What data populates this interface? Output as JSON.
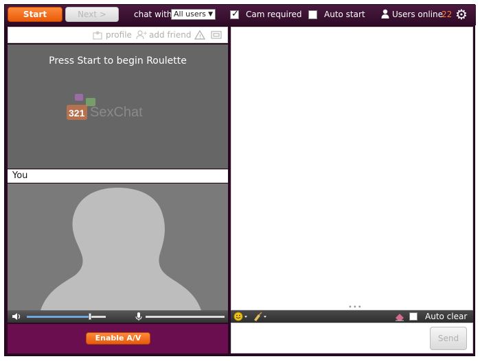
{
  "colors": {
    "frame": "#2a0a22",
    "accent_orange": "#e85a0a",
    "enable_panel": "#6a0e4f",
    "count_orange": "#ff7a2a"
  },
  "topbar": {
    "start_label": "Start",
    "next_label": "Next >",
    "chat_with_label": "chat with",
    "chat_with_selected": "All users",
    "cam_required_label": "Cam required",
    "cam_required_checked": true,
    "auto_start_label": "Auto start",
    "auto_start_checked": false,
    "users_online_label": "Users online",
    "users_online_count": "22"
  },
  "partner": {
    "toolbar": {
      "profile_label": "profile",
      "add_friend_label": "add friend"
    },
    "message": "Press Start to begin Roulette",
    "logo_text": "321SexChat"
  },
  "self": {
    "you_label": "You",
    "volume_level": 0.8,
    "mic_level": 0.0,
    "enable_av_label": "Enable A/V"
  },
  "chat": {
    "auto_clear_label": "Auto clear",
    "auto_clear_checked": false,
    "send_label": "Send"
  }
}
